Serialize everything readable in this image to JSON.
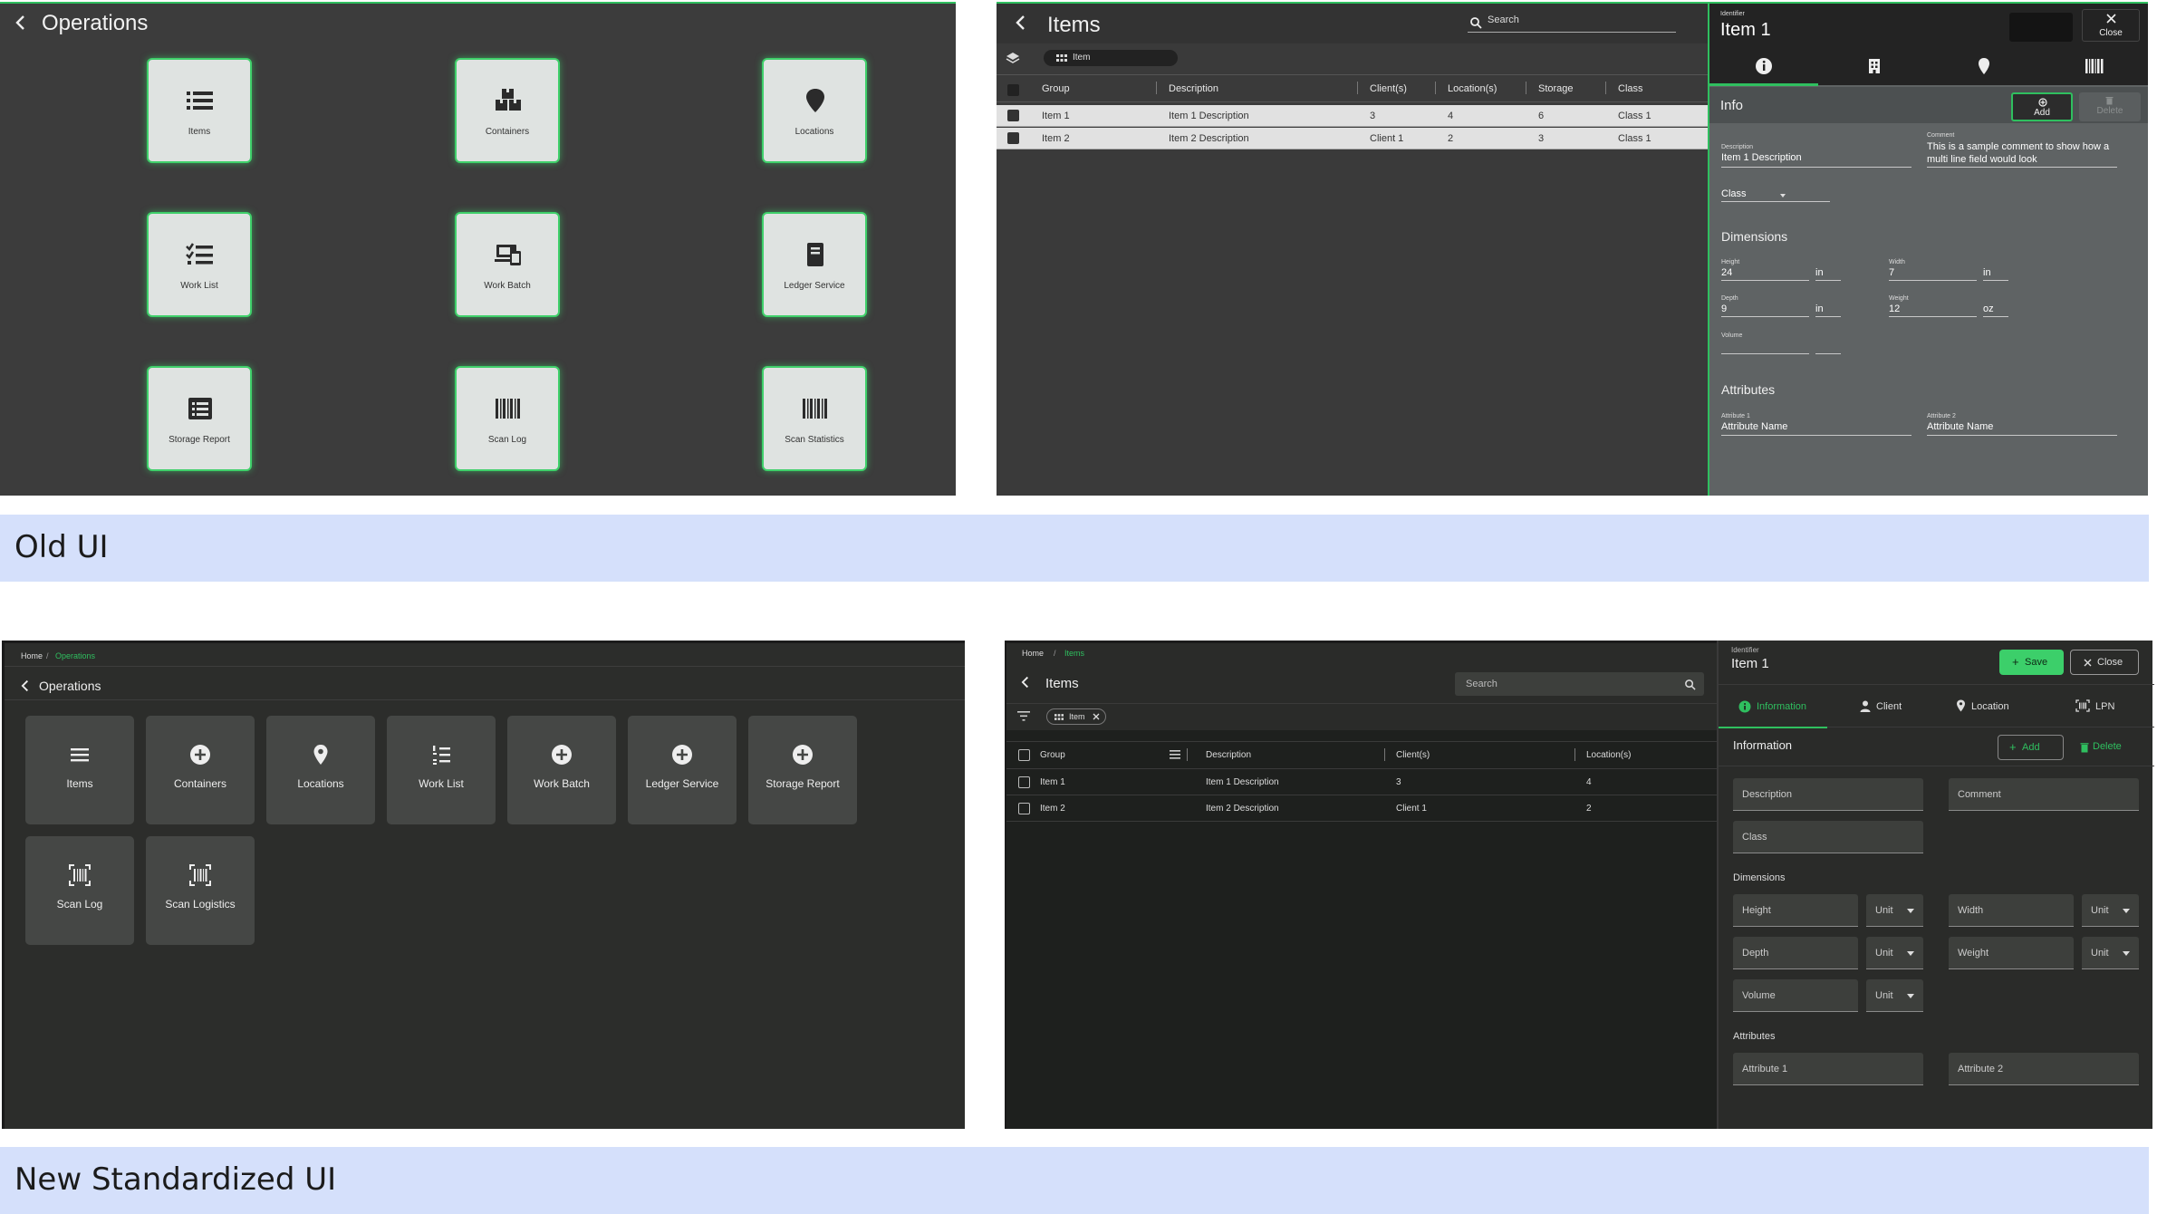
{
  "captions": {
    "old": "Old UI",
    "new": "New Standardized UI"
  },
  "colors": {
    "accent": "#2fbf5f",
    "caption_bg": "#d5e0fb"
  },
  "old_ui": {
    "operations": {
      "title": "Operations",
      "tiles": [
        {
          "label": "Items",
          "icon": "list-icon"
        },
        {
          "label": "Containers",
          "icon": "boxes-icon"
        },
        {
          "label": "Locations",
          "icon": "location-pin-icon"
        },
        {
          "label": "Work List",
          "icon": "checklist-icon"
        },
        {
          "label": "Work Batch",
          "icon": "devices-icon"
        },
        {
          "label": "Ledger Service",
          "icon": "book-icon"
        },
        {
          "label": "Storage Report",
          "icon": "report-list-icon"
        },
        {
          "label": "Scan Log",
          "icon": "barcode-icon"
        },
        {
          "label": "Scan Statistics",
          "icon": "barcode-icon"
        }
      ]
    },
    "items": {
      "title": "Items",
      "search_placeholder": "Search",
      "chip": "Item",
      "columns": [
        "Group",
        "Description",
        "Client(s)",
        "Location(s)",
        "Storage",
        "Class"
      ],
      "rows": [
        [
          "Item 1",
          "Item 1 Description",
          "3",
          "4",
          "6",
          "Class 1"
        ],
        [
          "Item 2",
          "Item 2 Description",
          "Client 1",
          "2",
          "3",
          "Class 1"
        ]
      ]
    },
    "detail": {
      "identifier_label": "Identifier",
      "identifier": "Item 1",
      "close": "Close",
      "section_info": "Info",
      "add": "Add",
      "delete": "Delete",
      "description_label": "Description",
      "description": "Item 1 Description",
      "comment_label": "Comment",
      "comment": "This is a sample comment to show how a multi line field would look",
      "class_label": "Class",
      "section_dimensions": "Dimensions",
      "height_label": "Height",
      "height": "24",
      "height_unit": "in",
      "width_label": "Width",
      "width": "7",
      "width_unit": "in",
      "depth_label": "Depth",
      "depth": "9",
      "depth_unit": "in",
      "weight_label": "Weight",
      "weight": "12",
      "weight_unit": "oz",
      "volume_label": "Volume",
      "section_attributes": "Attributes",
      "attr1_label": "Attribute 1",
      "attr1": "Attribute Name",
      "attr2_label": "Attribute 2",
      "attr2": "Attribute Name"
    }
  },
  "new_ui": {
    "operations": {
      "breadcrumb": [
        "Home",
        "/",
        "Operations"
      ],
      "title": "Operations",
      "tiles": [
        {
          "label": "Items",
          "icon": "menu-icon"
        },
        {
          "label": "Containers",
          "icon": "plus-circle-icon"
        },
        {
          "label": "Locations",
          "icon": "location-pin-icon"
        },
        {
          "label": "Work List",
          "icon": "numbered-list-icon"
        },
        {
          "label": "Work Batch",
          "icon": "plus-circle-icon"
        },
        {
          "label": "Ledger Service",
          "icon": "plus-circle-icon"
        },
        {
          "label": "Storage Report",
          "icon": "plus-circle-icon"
        },
        {
          "label": "Scan Log",
          "icon": "barcode-scan-icon"
        },
        {
          "label": "Scan Logistics",
          "icon": "barcode-scan-icon"
        }
      ]
    },
    "items": {
      "breadcrumb": [
        "Home",
        "/",
        "Items"
      ],
      "title": "Items",
      "search_placeholder": "Search",
      "chip": "Item",
      "columns": [
        "Group",
        "Description",
        "Client(s)",
        "Location(s)"
      ],
      "rows": [
        [
          "Item 1",
          "Item 1 Description",
          "3",
          "4"
        ],
        [
          "Item 2",
          "Item 2 Description",
          "Client 1",
          "2"
        ]
      ]
    },
    "detail": {
      "identifier_label": "Identifier",
      "identifier": "Item 1",
      "save": "Save",
      "close": "Close",
      "tabs": [
        "Information",
        "Client",
        "Location",
        "LPN"
      ],
      "section_info": "Information",
      "add": "Add",
      "delete": "Delete",
      "description": "Description",
      "comment": "Comment",
      "class": "Class",
      "section_dimensions": "Dimensions",
      "height": "Height",
      "width": "Width",
      "depth": "Depth",
      "weight": "Weight",
      "volume": "Volume",
      "unit": "Unit",
      "section_attributes": "Attributes",
      "attr1": "Attribute 1",
      "attr2": "Attribute 2"
    }
  }
}
